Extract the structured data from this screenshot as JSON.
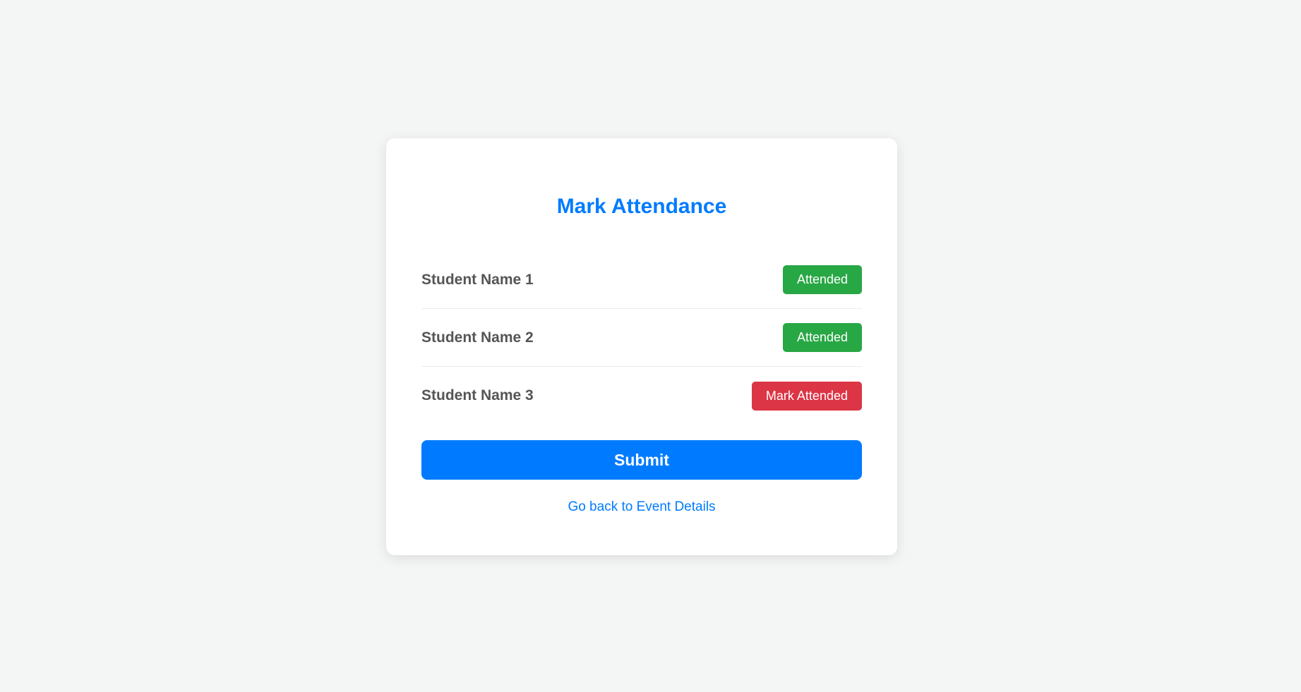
{
  "page": {
    "title": "Mark Attendance"
  },
  "students": [
    {
      "name": "Student Name 1",
      "status_label": "Attended",
      "status": "attended"
    },
    {
      "name": "Student Name 2",
      "status_label": "Attended",
      "status": "attended"
    },
    {
      "name": "Student Name 3",
      "status_label": "Mark Attended",
      "status": "pending"
    }
  ],
  "actions": {
    "submit_label": "Submit",
    "back_link_label": "Go back to Event Details"
  },
  "colors": {
    "primary": "#007bff",
    "attended": "#28a745",
    "pending": "#dc3545",
    "background": "#f4f5f5",
    "card": "#ffffff",
    "name_text": "#555555"
  }
}
